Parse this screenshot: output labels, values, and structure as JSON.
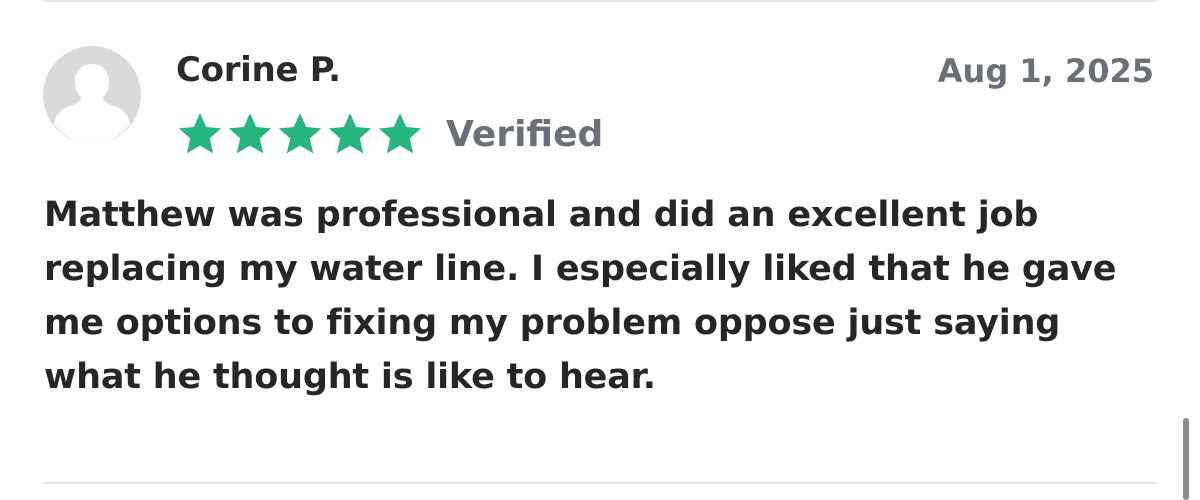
{
  "review": {
    "reviewer_name": "Corine P.",
    "date": "Aug 1, 2025",
    "rating": 5,
    "rating_max": 5,
    "verified_label": "Verified",
    "body": "Matthew was professional and did an excellent job replacing my water line. I especially liked that he gave me options to fixing my problem oppose just saying what he thought is like to hear.",
    "avatar_icon": "default-user-avatar-icon"
  },
  "colors": {
    "star": "#27b57e",
    "muted_text": "#6b7078",
    "avatar_bg": "#d9dadb",
    "avatar_figure": "#ffffff",
    "divider": "#e8e8e8",
    "scrollbar": "#8d8d8d"
  }
}
